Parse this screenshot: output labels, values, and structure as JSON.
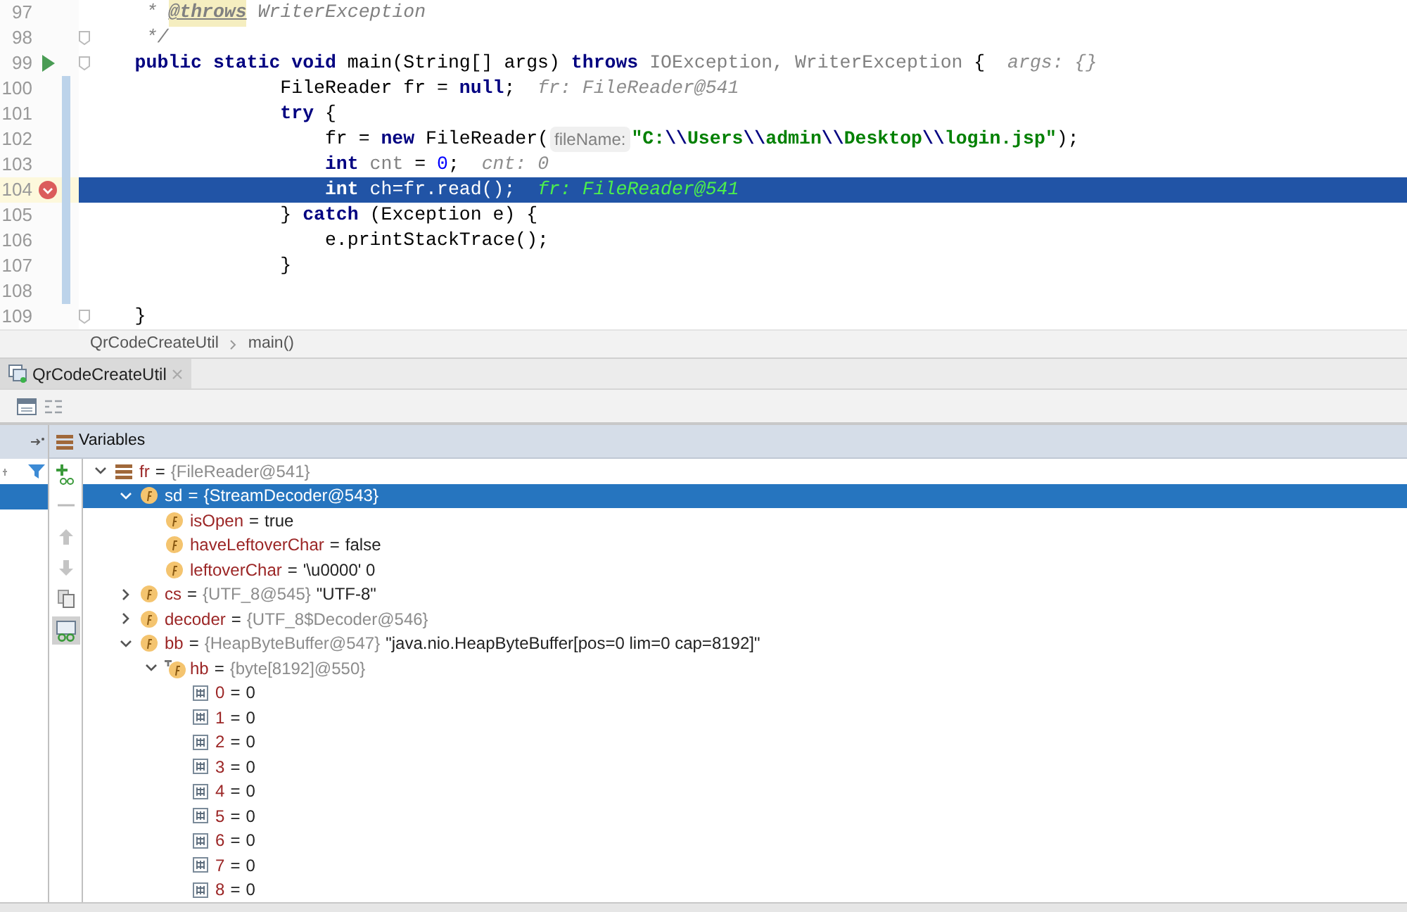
{
  "editor": {
    "lines": [
      {
        "number": "97",
        "tokens": [
          {
            "kind": "comment",
            "text": "     * "
          },
          {
            "kind": "doctag",
            "text": "@throws"
          },
          {
            "kind": "comment",
            "text": " WriterException"
          }
        ]
      },
      {
        "number": "98",
        "fold": true,
        "tokens": [
          {
            "kind": "comment",
            "text": "     */"
          }
        ]
      },
      {
        "number": "99",
        "fold": true,
        "run": true,
        "tokens": [
          {
            "kind": "keyword",
            "text": "    public static void"
          },
          {
            "kind": "plain",
            "text": " main(String[] args) "
          },
          {
            "kind": "keyword",
            "text": "throws"
          },
          {
            "kind": "unused",
            "text": " IOException, WriterException"
          },
          {
            "kind": "plain",
            "text": " {"
          },
          {
            "kind": "hint",
            "text": "  args: {}"
          }
        ]
      },
      {
        "number": "100",
        "changed": true,
        "tokens": [
          {
            "kind": "plain",
            "text": "                 FileReader fr = "
          },
          {
            "kind": "keyword",
            "text": "null"
          },
          {
            "kind": "plain",
            "text": ";"
          },
          {
            "kind": "hint",
            "text": "  fr: FileReader@541"
          }
        ]
      },
      {
        "number": "101",
        "changed": true,
        "tokens": [
          {
            "kind": "keyword",
            "text": "                 try"
          },
          {
            "kind": "plain",
            "text": " {"
          }
        ]
      },
      {
        "number": "102",
        "changed": true,
        "tokens": [
          {
            "kind": "plain",
            "text": "                     fr = "
          },
          {
            "kind": "keyword",
            "text": "new"
          },
          {
            "kind": "plain",
            "text": " FileReader("
          },
          {
            "kind": "inlay",
            "text": "fileName:"
          },
          {
            "kind": "string",
            "text": "\"C:"
          },
          {
            "kind": "escape",
            "text": "\\\\"
          },
          {
            "kind": "string",
            "text": "Users"
          },
          {
            "kind": "escape",
            "text": "\\\\"
          },
          {
            "kind": "string",
            "text": "admin"
          },
          {
            "kind": "escape",
            "text": "\\\\"
          },
          {
            "kind": "string",
            "text": "Desktop"
          },
          {
            "kind": "escape",
            "text": "\\\\"
          },
          {
            "kind": "string",
            "text": "login.jsp\""
          },
          {
            "kind": "plain",
            "text": ");"
          }
        ]
      },
      {
        "number": "103",
        "changed": true,
        "tokens": [
          {
            "kind": "keyword",
            "text": "                     int"
          },
          {
            "kind": "unused",
            "text": " cnt"
          },
          {
            "kind": "plain",
            "text": " = "
          },
          {
            "kind": "number",
            "text": "0"
          },
          {
            "kind": "plain",
            "text": ";"
          },
          {
            "kind": "hint",
            "text": "  cnt: 0"
          }
        ]
      },
      {
        "number": "104",
        "changed": true,
        "breakpoint": true,
        "current": true,
        "tokens": [
          {
            "kind": "keyword",
            "text": "                     int"
          },
          {
            "kind": "plain",
            "text": " ch=fr.read();"
          },
          {
            "kind": "hint",
            "text": "  fr: FileReader@541"
          }
        ]
      },
      {
        "number": "105",
        "changed": true,
        "tokens": [
          {
            "kind": "plain",
            "text": "                 } "
          },
          {
            "kind": "keyword",
            "text": "catch"
          },
          {
            "kind": "plain",
            "text": " (Exception e) {"
          }
        ]
      },
      {
        "number": "106",
        "changed": true,
        "tokens": [
          {
            "kind": "plain",
            "text": "                     e.printStackTrace();"
          }
        ]
      },
      {
        "number": "107",
        "changed": true,
        "tokens": [
          {
            "kind": "plain",
            "text": "                 }"
          }
        ]
      },
      {
        "number": "108",
        "changed": true
      },
      {
        "number": "109",
        "fold": true,
        "tokens": [
          {
            "kind": "plain",
            "text": "    }"
          }
        ]
      }
    ]
  },
  "breadcrumb": [
    "QrCodeCreateUtil",
    "main()"
  ],
  "debug_tabs": [
    {
      "label": "QrCodeCreateUtil",
      "selected": true
    }
  ],
  "frames": [
    {
      "selected": true
    }
  ],
  "variables": {
    "title": "Variables",
    "tree": [
      {
        "kind": "object",
        "name": "fr",
        "op": "=",
        "type": "{FileReader@541}",
        "expanded": true,
        "selected": false,
        "children": [
          {
            "kind": "field",
            "name": "sd",
            "op": "=",
            "type": "{StreamDecoder@543}",
            "expanded": true,
            "selected": true,
            "children": [
              {
                "kind": "field",
                "name": "isOpen",
                "op": "=",
                "value": "true",
                "selected": false
              },
              {
                "kind": "field",
                "name": "haveLeftoverChar",
                "op": "=",
                "value": "false",
                "selected": false
              },
              {
                "kind": "field",
                "name": "leftoverChar",
                "op": "=",
                "value": "'\\u0000' 0",
                "selected": false
              }
            ]
          },
          {
            "kind": "field",
            "name": "cs",
            "op": "=",
            "type": "{UTF_8@545}",
            "value": "\"UTF-8\"",
            "expanded": false,
            "selected": false
          },
          {
            "kind": "field",
            "name": "decoder",
            "op": "=",
            "type": "{UTF_8$Decoder@546}",
            "expanded": false,
            "selected": false
          },
          {
            "kind": "field",
            "name": "bb",
            "op": "=",
            "type": "{HeapByteBuffer@547}",
            "value": "\"java.nio.HeapByteBuffer[pos=0 lim=0 cap=8192]\"",
            "expanded": true,
            "selected": false,
            "children": [
              {
                "kind": "final-field",
                "name": "hb",
                "op": "=",
                "type": "{byte[8192]@550}",
                "expanded": true,
                "selected": false,
                "children": [
                  {
                    "kind": "element",
                    "name": "0",
                    "op": "=",
                    "value": "0",
                    "selected": false
                  },
                  {
                    "kind": "element",
                    "name": "1",
                    "op": "=",
                    "value": "0",
                    "selected": false
                  },
                  {
                    "kind": "element",
                    "name": "2",
                    "op": "=",
                    "value": "0",
                    "selected": false
                  },
                  {
                    "kind": "element",
                    "name": "3",
                    "op": "=",
                    "value": "0",
                    "selected": false
                  },
                  {
                    "kind": "element",
                    "name": "4",
                    "op": "=",
                    "value": "0",
                    "selected": false
                  },
                  {
                    "kind": "element",
                    "name": "5",
                    "op": "=",
                    "value": "0",
                    "selected": false
                  },
                  {
                    "kind": "element",
                    "name": "6",
                    "op": "=",
                    "value": "0",
                    "selected": false
                  },
                  {
                    "kind": "element",
                    "name": "7",
                    "op": "=",
                    "value": "0",
                    "selected": false
                  },
                  {
                    "kind": "element",
                    "name": "8",
                    "op": "=",
                    "value": "0",
                    "selected": false
                  }
                ]
              }
            ]
          }
        ]
      }
    ]
  }
}
